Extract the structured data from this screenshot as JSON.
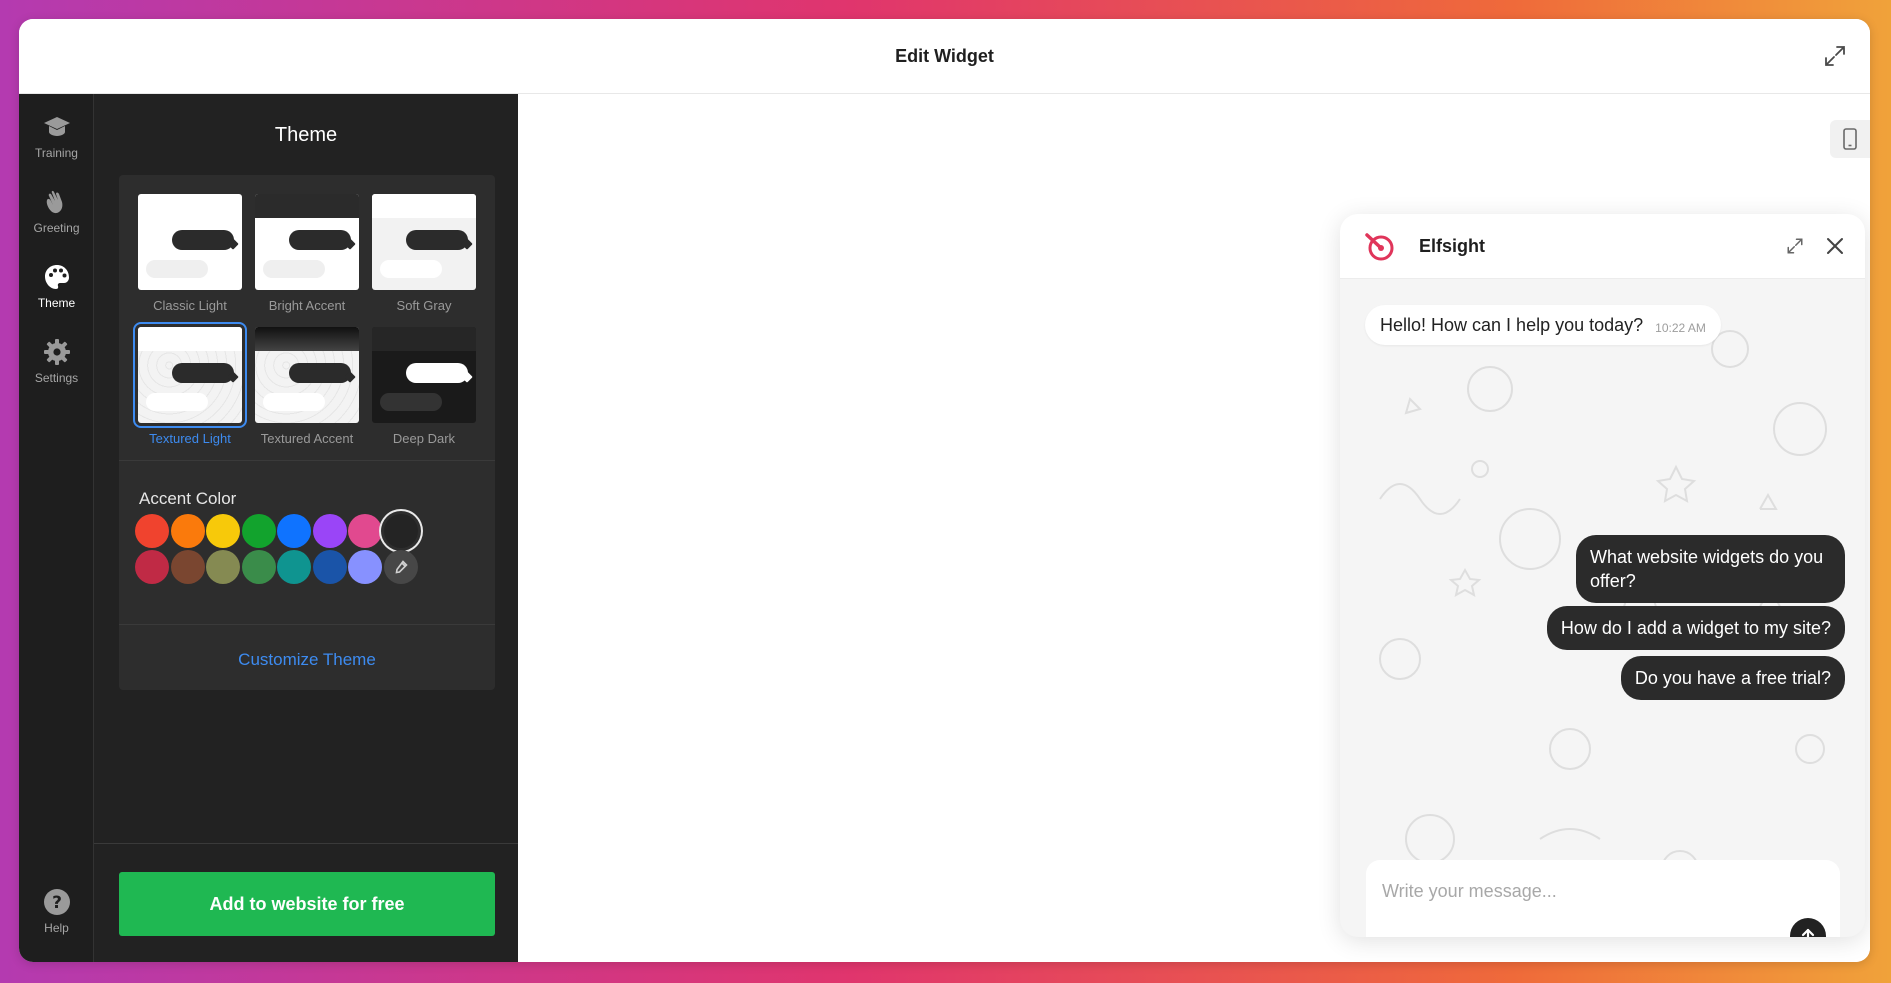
{
  "window": {
    "title": "Edit Widget"
  },
  "rail": {
    "items": [
      {
        "label": "Training",
        "icon": "graduation-cap-icon"
      },
      {
        "label": "Greeting",
        "icon": "waving-hand-icon"
      },
      {
        "label": "Theme",
        "icon": "palette-icon",
        "active": true
      },
      {
        "label": "Settings",
        "icon": "gear-icon"
      }
    ],
    "help_label": "Help"
  },
  "panel": {
    "title": "Theme",
    "themes": [
      {
        "label": "Classic Light"
      },
      {
        "label": "Bright Accent"
      },
      {
        "label": "Soft Gray"
      },
      {
        "label": "Textured Light",
        "selected": true
      },
      {
        "label": "Textured Accent"
      },
      {
        "label": "Deep Dark"
      }
    ],
    "accent_title": "Accent Color",
    "accent_colors_row1": [
      "#f0432e",
      "#fa7a0c",
      "#f7c90a",
      "#12a32d",
      "#0f73ff",
      "#9a45f7",
      "#e1498f",
      "#242424"
    ],
    "accent_colors_row2": [
      "#c02a45",
      "#7a4630",
      "#858a52",
      "#3a8c4a",
      "#0f9490",
      "#1a54a8",
      "#8791ff"
    ],
    "selected_accent": "#242424",
    "customize_label": "Customize Theme",
    "cta_label": "Add to website for free"
  },
  "chat": {
    "name": "Elfsight",
    "greeting": "Hello! How can I help you today?",
    "greeting_time": "10:22 AM",
    "suggestions": [
      "What website widgets do you offer?",
      "How do I add a widget to my site?",
      "Do you have a free trial?"
    ],
    "input_placeholder": "Write your message..."
  },
  "colors": {
    "cta": "#1fb852",
    "link": "#3d8bf0",
    "panel_bg": "#222222",
    "brand_red": "#e0355a"
  }
}
